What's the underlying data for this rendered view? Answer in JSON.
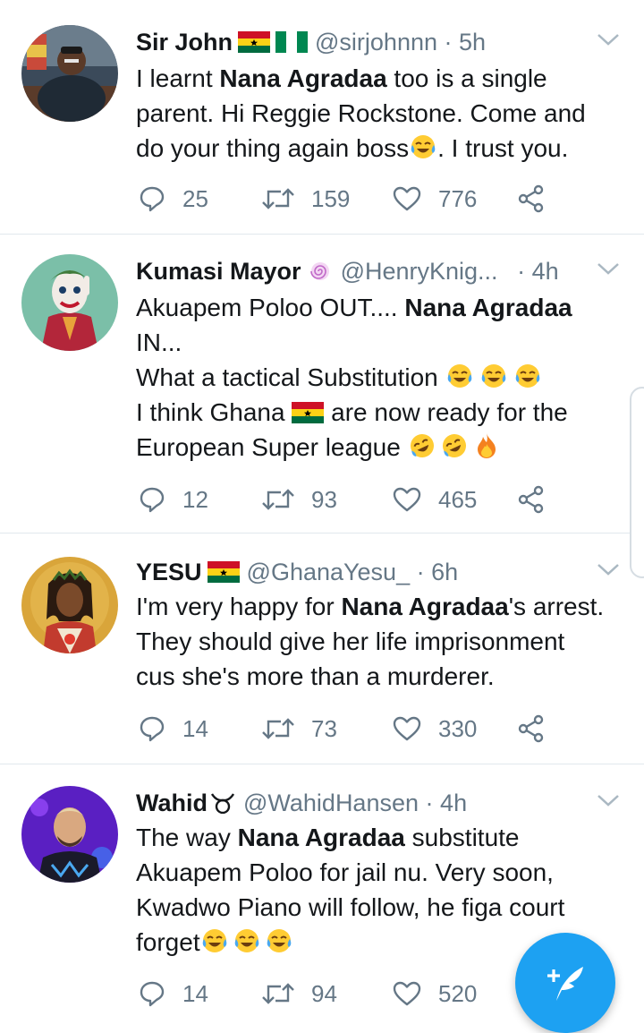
{
  "tweets": [
    {
      "name": "Sir John",
      "handle": "@sirjohnnn",
      "dot": "·",
      "time": "5h",
      "lines": [
        {
          "pre": "I learnt ",
          "bold": "Nana Agradaa",
          "post": " too is a single"
        },
        {
          "pre": "parent. Hi Reggie Rockstone. Come and"
        },
        {
          "pre": "do your thing again boss",
          "post": ". I trust you."
        }
      ],
      "replies": "25",
      "retweets": "159",
      "likes": "776"
    },
    {
      "name": "Kumasi Mayor",
      "handle": "@HenryKnig...",
      "dot": "·",
      "time": "4h",
      "lines": [
        {
          "pre": "Akuapem Poloo OUT.... ",
          "bold": "Nana Agradaa"
        },
        {
          "pre": "IN..."
        },
        {
          "pre": "What a tactical Substitution "
        },
        {
          "pre": "I think Ghana ",
          "post": " are now ready for the"
        },
        {
          "pre": "European Super league "
        }
      ],
      "replies": "12",
      "retweets": "93",
      "likes": "465"
    },
    {
      "name": "YESU",
      "handle": "@GhanaYesu_",
      "dot": "·",
      "time": "6h",
      "lines": [
        {
          "pre": "I'm very happy for ",
          "bold": "Nana Agradaa",
          "post": "'s arrest."
        },
        {
          "pre": "They should give her life imprisonment"
        },
        {
          "pre": "cus she's more than a murderer."
        }
      ],
      "replies": "14",
      "retweets": "73",
      "likes": "330"
    },
    {
      "name": "Wahid",
      "handle": "@WahidHansen",
      "dot": "·",
      "time": "4h",
      "lines": [
        {
          "pre": "The way ",
          "bold": "Nana Agradaa",
          "post": " substitute"
        },
        {
          "pre": "Akuapem Poloo for jail nu. Very soon,"
        },
        {
          "pre": "Kwadwo Piano will follow, he figa court"
        },
        {
          "pre": "forget"
        }
      ],
      "replies": "14",
      "retweets": "94",
      "likes": "520"
    }
  ],
  "colors": {
    "accent": "#1da1f2",
    "text": "#14171a",
    "secondary": "#657786",
    "divider": "#e1e8ed"
  },
  "icons": [
    "reply-icon",
    "retweet-icon",
    "like-icon",
    "share-icon",
    "chevron-down-icon",
    "compose-tweet-icon"
  ]
}
